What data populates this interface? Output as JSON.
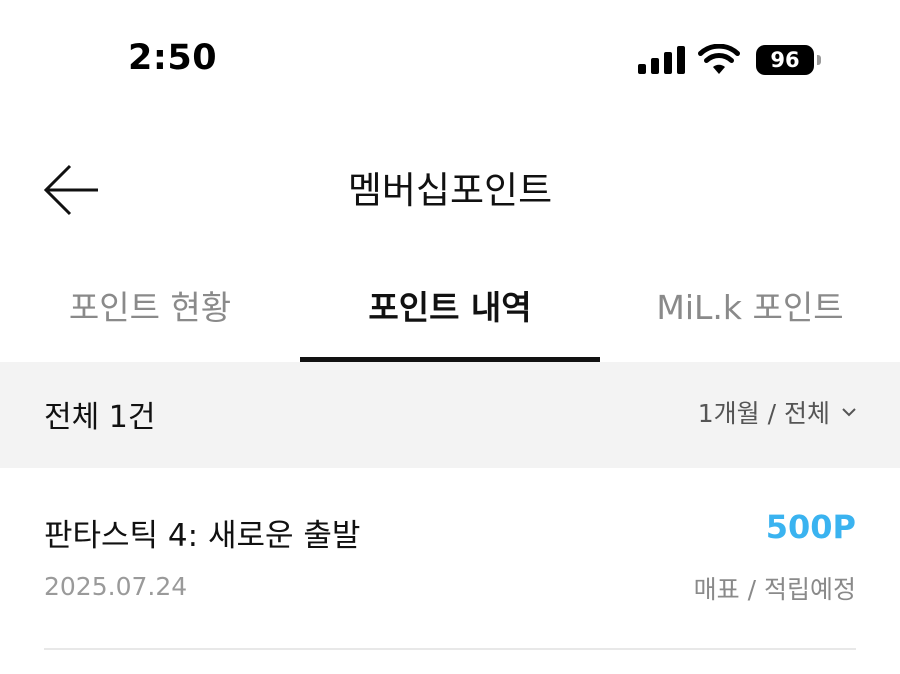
{
  "status_bar": {
    "time": "2:50",
    "battery": "96"
  },
  "header": {
    "title": "멤버십포인트"
  },
  "tabs": [
    {
      "label": "포인트 현황"
    },
    {
      "label": "포인트 내역"
    },
    {
      "label": "MiL.k 포인트"
    }
  ],
  "filter": {
    "total": "전체 1건",
    "period": "1개월 / 전체"
  },
  "transactions": [
    {
      "title": "판타스틱 4: 새로운 출발",
      "points": "500P",
      "date": "2025.07.24",
      "status": "매표 / 적립예정"
    }
  ],
  "colors": {
    "accent": "#3ab3f0",
    "filter_bg": "#f3f3f3",
    "active_tab": "#111111"
  }
}
